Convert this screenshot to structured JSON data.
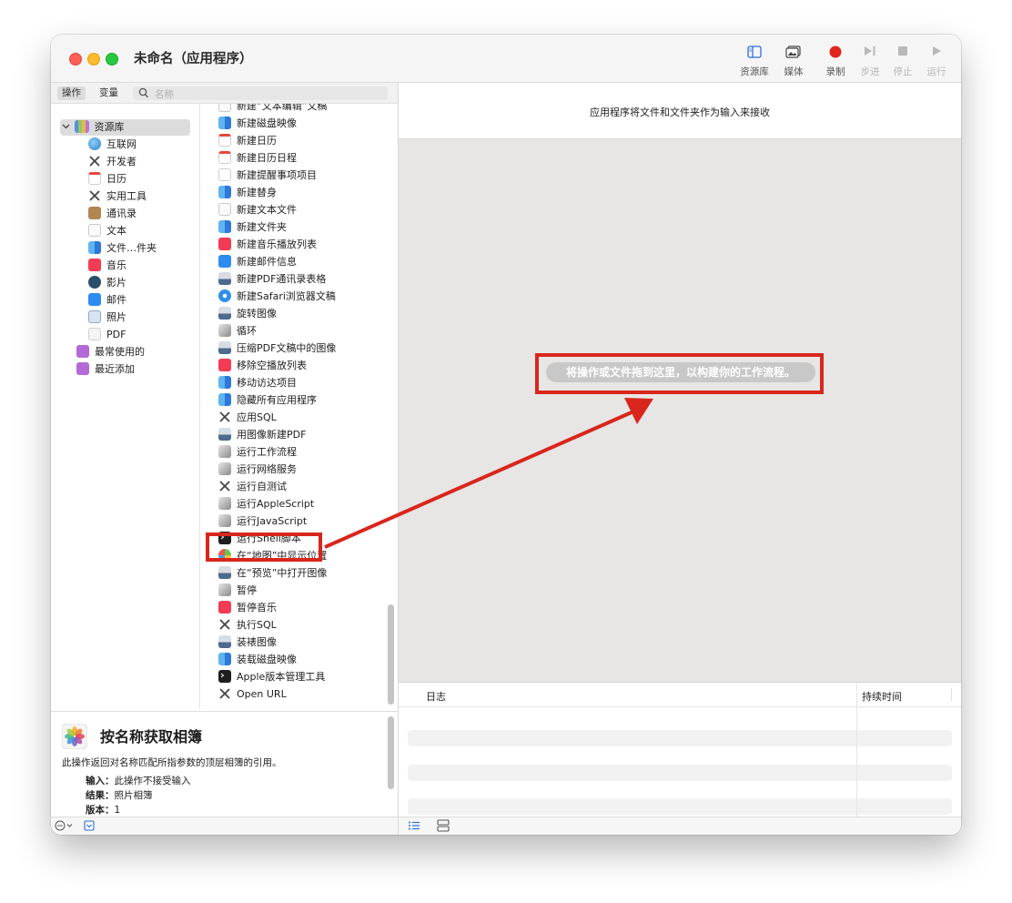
{
  "window": {
    "title": "未命名（应用程序）"
  },
  "toolbar": {
    "library_label": "资源库",
    "media_label": "媒体",
    "record_label": "录制",
    "step_label": "步进",
    "stop_label": "停止",
    "run_label": "运行",
    "record_color": "#e0271d"
  },
  "left": {
    "tab_actions": "操作",
    "tab_variables": "变量",
    "search_placeholder": "名称",
    "library_root": "资源库",
    "library_items": [
      {
        "label": "互联网",
        "icon": "globe-icon"
      },
      {
        "label": "开发者",
        "icon": "tools-icon"
      },
      {
        "label": "日历",
        "icon": "calendar-icon"
      },
      {
        "label": "实用工具",
        "icon": "tools-icon"
      },
      {
        "label": "通讯录",
        "icon": "contacts-icon"
      },
      {
        "label": "文本",
        "icon": "text-icon"
      },
      {
        "label": "文件…件夹",
        "icon": "finder-icon"
      },
      {
        "label": "音乐",
        "icon": "music-icon"
      },
      {
        "label": "影片",
        "icon": "movie-icon"
      },
      {
        "label": "邮件",
        "icon": "mail-icon"
      },
      {
        "label": "照片",
        "icon": "photo-icon"
      },
      {
        "label": "PDF",
        "icon": "pdf-icon"
      }
    ],
    "smart_groups": [
      {
        "label": "最常使用的",
        "icon": "smart-folder-icon"
      },
      {
        "label": "最近添加",
        "icon": "smart-folder-icon"
      }
    ],
    "actions": [
      {
        "label": "新建“文本编辑”文稿",
        "icon": "text-icon"
      },
      {
        "label": "新建磁盘映像",
        "icon": "finder-icon"
      },
      {
        "label": "新建日历",
        "icon": "calendar-icon"
      },
      {
        "label": "新建日历日程",
        "icon": "calendar-icon"
      },
      {
        "label": "新建提醒事项项目",
        "icon": "reminders-icon"
      },
      {
        "label": "新建替身",
        "icon": "finder-icon"
      },
      {
        "label": "新建文本文件",
        "icon": "text-icon"
      },
      {
        "label": "新建文件夹",
        "icon": "finder-icon"
      },
      {
        "label": "新建音乐播放列表",
        "icon": "music-icon"
      },
      {
        "label": "新建邮件信息",
        "icon": "mail-icon"
      },
      {
        "label": "新建PDF通讯录表格",
        "icon": "preview-icon"
      },
      {
        "label": "新建Safari浏览器文稿",
        "icon": "safari-icon"
      },
      {
        "label": "旋转图像",
        "icon": "preview-icon"
      },
      {
        "label": "循环",
        "icon": "automator-icon"
      },
      {
        "label": "压缩PDF文稿中的图像",
        "icon": "preview-icon"
      },
      {
        "label": "移除空播放列表",
        "icon": "music-icon"
      },
      {
        "label": "移动访达项目",
        "icon": "finder-icon"
      },
      {
        "label": "隐藏所有应用程序",
        "icon": "finder-icon"
      },
      {
        "label": "应用SQL",
        "icon": "tools-icon"
      },
      {
        "label": "用图像新建PDF",
        "icon": "preview-icon"
      },
      {
        "label": "运行工作流程",
        "icon": "automator-icon"
      },
      {
        "label": "运行网络服务",
        "icon": "automator-icon"
      },
      {
        "label": "运行自测试",
        "icon": "tools-icon"
      },
      {
        "label": "运行AppleScript",
        "icon": "automator-icon"
      },
      {
        "label": "运行JavaScript",
        "icon": "automator-icon"
      },
      {
        "label": "运行Shell脚本",
        "icon": "terminal-icon"
      },
      {
        "label": "在“地图”中显示位置",
        "icon": "maps-icon"
      },
      {
        "label": "在“预览”中打开图像",
        "icon": "preview-icon"
      },
      {
        "label": "暂停",
        "icon": "automator-icon"
      },
      {
        "label": "暂停音乐",
        "icon": "music-icon"
      },
      {
        "label": "执行SQL",
        "icon": "tools-icon"
      },
      {
        "label": "装裱图像",
        "icon": "preview-icon"
      },
      {
        "label": "装载磁盘映像",
        "icon": "finder-icon"
      },
      {
        "label": "Apple版本管理工具",
        "icon": "terminal-icon"
      },
      {
        "label": "Open URL",
        "icon": "tools-icon"
      }
    ],
    "description": {
      "title": "按名称获取相簿",
      "body": "此操作返回对名称匹配所指参数的顶层相簿的引用。",
      "input_key": "输入：",
      "input_value": "此操作不接受输入",
      "result_key": "结果：",
      "result_value": "照片相簿",
      "version_key": "版本：",
      "version_value": "1"
    }
  },
  "right": {
    "input_note": "应用程序将文件和文件夹作为输入来接收",
    "drop_hint": "将操作或文件拖到这里，以构建你的工作流程。",
    "log_col": "日志",
    "duration_col": "持续时间"
  },
  "annotation": {
    "color": "#d9261c"
  }
}
